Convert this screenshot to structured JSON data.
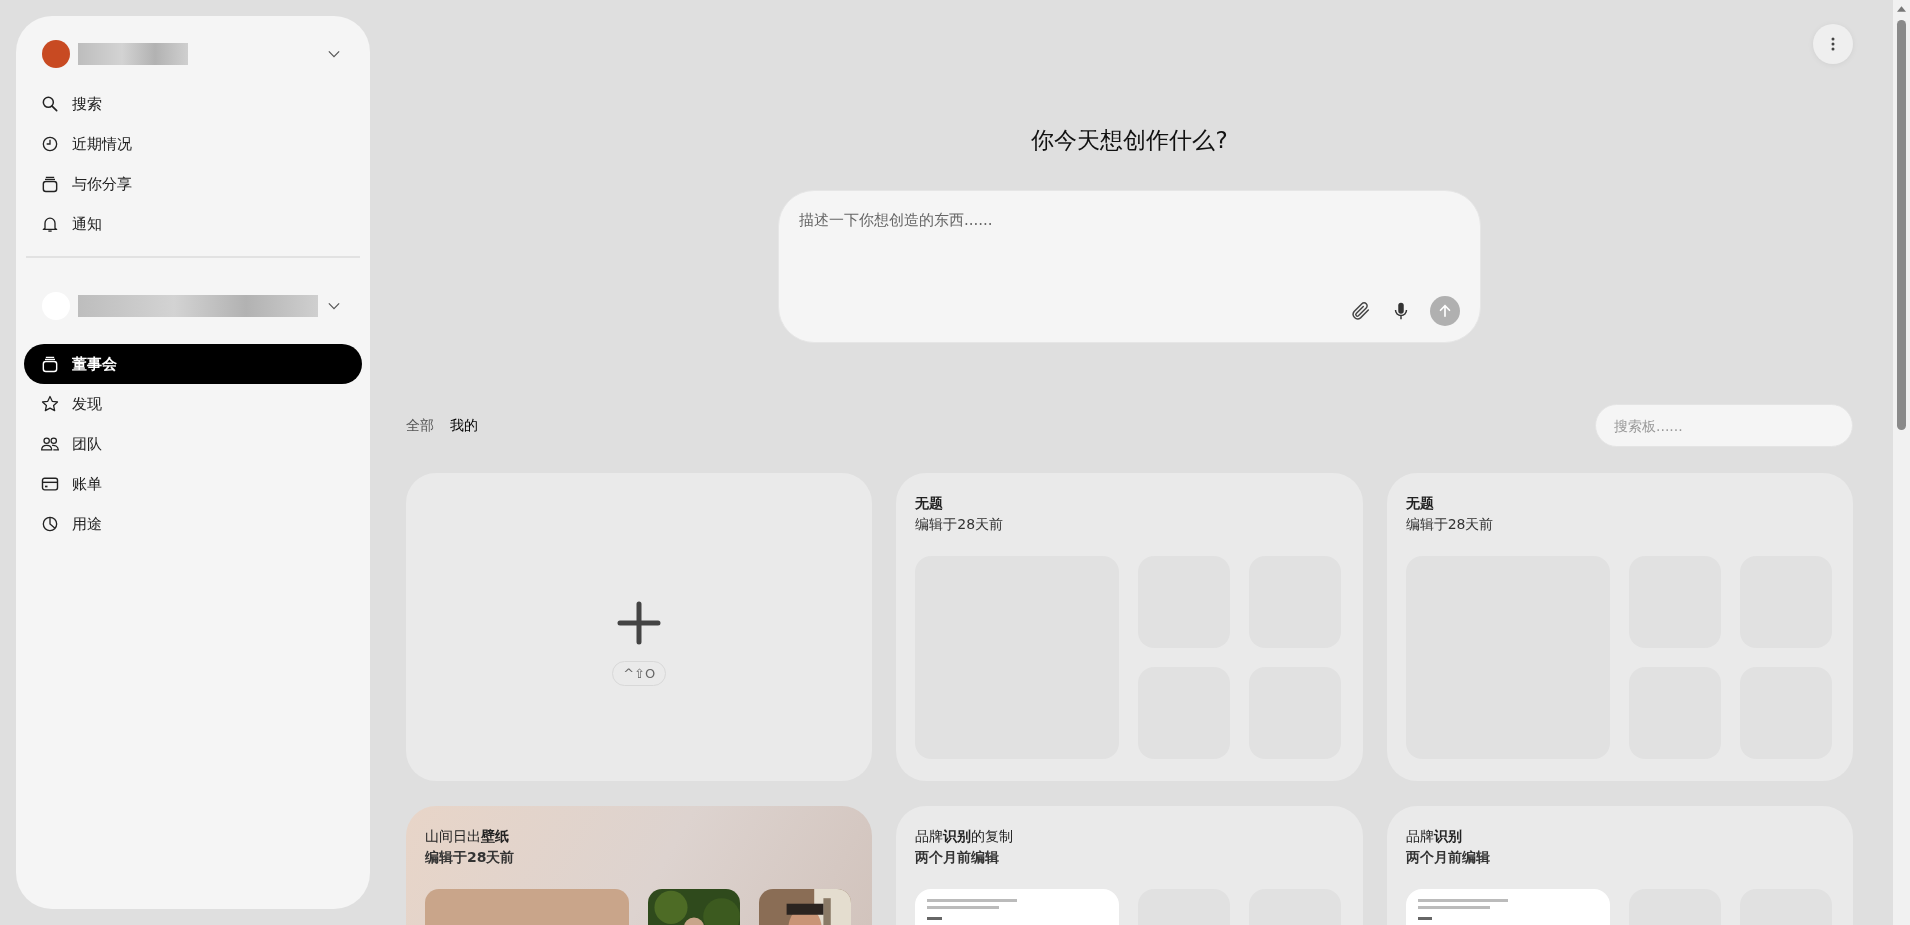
{
  "sidebar": {
    "nav_items": [
      {
        "kind": "search",
        "label": "搜索",
        "selected": false
      },
      {
        "kind": "clock",
        "label": "近期情况",
        "selected": false
      },
      {
        "kind": "stack",
        "label": "与你分享",
        "selected": false
      },
      {
        "kind": "bell",
        "label": "通知",
        "selected": false
      }
    ],
    "workspace_items": [
      {
        "kind": "stack",
        "label": "董事会",
        "selected": true
      },
      {
        "kind": "star",
        "label": "发现",
        "selected": false
      },
      {
        "kind": "people",
        "label": "团队",
        "selected": false
      },
      {
        "kind": "card",
        "label": "账单",
        "selected": false
      },
      {
        "kind": "pie",
        "label": "用途",
        "selected": false
      }
    ]
  },
  "main": {
    "heading": "你今天想创作什么?",
    "prompt": {
      "placeholder": "描述一下你想创造的东西......"
    },
    "filters": [
      {
        "label": "全部",
        "selected": false
      },
      {
        "label": "我的",
        "selected": true
      }
    ],
    "board_search": {
      "placeholder": "搜索板......"
    },
    "new_board": {
      "shortcut": "^⇧O"
    },
    "boards": [
      {
        "kind": "grid",
        "title": "无题",
        "edited": "编辑于28天前",
        "title_bold": true,
        "edited_bold": false
      },
      {
        "kind": "grid",
        "title": "无题",
        "edited": "编辑于28天前",
        "title_bold": true,
        "edited_bold": false
      },
      {
        "kind": "photos",
        "title": "山间日出**壁纸**",
        "edited": "编辑于28天前",
        "title_bold": false,
        "edited_bold": true
      },
      {
        "kind": "document",
        "title": "品牌**识别**的复制",
        "edited": "两个月前编辑",
        "title_bold": false,
        "edited_bold": true
      },
      {
        "kind": "document",
        "title": "品牌**识别**",
        "edited": "两个月前编辑",
        "title_bold": false,
        "edited_bold": true
      }
    ]
  }
}
